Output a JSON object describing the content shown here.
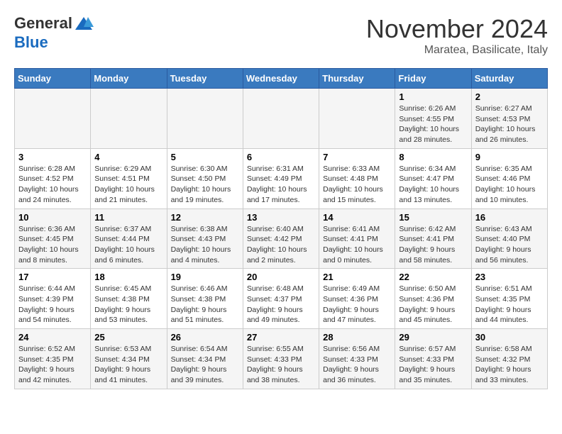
{
  "header": {
    "logo_general": "General",
    "logo_blue": "Blue",
    "month_title": "November 2024",
    "location": "Maratea, Basilicate, Italy"
  },
  "weekdays": [
    "Sunday",
    "Monday",
    "Tuesday",
    "Wednesday",
    "Thursday",
    "Friday",
    "Saturday"
  ],
  "weeks": [
    [
      {
        "day": "",
        "info": ""
      },
      {
        "day": "",
        "info": ""
      },
      {
        "day": "",
        "info": ""
      },
      {
        "day": "",
        "info": ""
      },
      {
        "day": "",
        "info": ""
      },
      {
        "day": "1",
        "info": "Sunrise: 6:26 AM\nSunset: 4:55 PM\nDaylight: 10 hours and 28 minutes."
      },
      {
        "day": "2",
        "info": "Sunrise: 6:27 AM\nSunset: 4:53 PM\nDaylight: 10 hours and 26 minutes."
      }
    ],
    [
      {
        "day": "3",
        "info": "Sunrise: 6:28 AM\nSunset: 4:52 PM\nDaylight: 10 hours and 24 minutes."
      },
      {
        "day": "4",
        "info": "Sunrise: 6:29 AM\nSunset: 4:51 PM\nDaylight: 10 hours and 21 minutes."
      },
      {
        "day": "5",
        "info": "Sunrise: 6:30 AM\nSunset: 4:50 PM\nDaylight: 10 hours and 19 minutes."
      },
      {
        "day": "6",
        "info": "Sunrise: 6:31 AM\nSunset: 4:49 PM\nDaylight: 10 hours and 17 minutes."
      },
      {
        "day": "7",
        "info": "Sunrise: 6:33 AM\nSunset: 4:48 PM\nDaylight: 10 hours and 15 minutes."
      },
      {
        "day": "8",
        "info": "Sunrise: 6:34 AM\nSunset: 4:47 PM\nDaylight: 10 hours and 13 minutes."
      },
      {
        "day": "9",
        "info": "Sunrise: 6:35 AM\nSunset: 4:46 PM\nDaylight: 10 hours and 10 minutes."
      }
    ],
    [
      {
        "day": "10",
        "info": "Sunrise: 6:36 AM\nSunset: 4:45 PM\nDaylight: 10 hours and 8 minutes."
      },
      {
        "day": "11",
        "info": "Sunrise: 6:37 AM\nSunset: 4:44 PM\nDaylight: 10 hours and 6 minutes."
      },
      {
        "day": "12",
        "info": "Sunrise: 6:38 AM\nSunset: 4:43 PM\nDaylight: 10 hours and 4 minutes."
      },
      {
        "day": "13",
        "info": "Sunrise: 6:40 AM\nSunset: 4:42 PM\nDaylight: 10 hours and 2 minutes."
      },
      {
        "day": "14",
        "info": "Sunrise: 6:41 AM\nSunset: 4:41 PM\nDaylight: 10 hours and 0 minutes."
      },
      {
        "day": "15",
        "info": "Sunrise: 6:42 AM\nSunset: 4:41 PM\nDaylight: 9 hours and 58 minutes."
      },
      {
        "day": "16",
        "info": "Sunrise: 6:43 AM\nSunset: 4:40 PM\nDaylight: 9 hours and 56 minutes."
      }
    ],
    [
      {
        "day": "17",
        "info": "Sunrise: 6:44 AM\nSunset: 4:39 PM\nDaylight: 9 hours and 54 minutes."
      },
      {
        "day": "18",
        "info": "Sunrise: 6:45 AM\nSunset: 4:38 PM\nDaylight: 9 hours and 53 minutes."
      },
      {
        "day": "19",
        "info": "Sunrise: 6:46 AM\nSunset: 4:38 PM\nDaylight: 9 hours and 51 minutes."
      },
      {
        "day": "20",
        "info": "Sunrise: 6:48 AM\nSunset: 4:37 PM\nDaylight: 9 hours and 49 minutes."
      },
      {
        "day": "21",
        "info": "Sunrise: 6:49 AM\nSunset: 4:36 PM\nDaylight: 9 hours and 47 minutes."
      },
      {
        "day": "22",
        "info": "Sunrise: 6:50 AM\nSunset: 4:36 PM\nDaylight: 9 hours and 45 minutes."
      },
      {
        "day": "23",
        "info": "Sunrise: 6:51 AM\nSunset: 4:35 PM\nDaylight: 9 hours and 44 minutes."
      }
    ],
    [
      {
        "day": "24",
        "info": "Sunrise: 6:52 AM\nSunset: 4:35 PM\nDaylight: 9 hours and 42 minutes."
      },
      {
        "day": "25",
        "info": "Sunrise: 6:53 AM\nSunset: 4:34 PM\nDaylight: 9 hours and 41 minutes."
      },
      {
        "day": "26",
        "info": "Sunrise: 6:54 AM\nSunset: 4:34 PM\nDaylight: 9 hours and 39 minutes."
      },
      {
        "day": "27",
        "info": "Sunrise: 6:55 AM\nSunset: 4:33 PM\nDaylight: 9 hours and 38 minutes."
      },
      {
        "day": "28",
        "info": "Sunrise: 6:56 AM\nSunset: 4:33 PM\nDaylight: 9 hours and 36 minutes."
      },
      {
        "day": "29",
        "info": "Sunrise: 6:57 AM\nSunset: 4:33 PM\nDaylight: 9 hours and 35 minutes."
      },
      {
        "day": "30",
        "info": "Sunrise: 6:58 AM\nSunset: 4:32 PM\nDaylight: 9 hours and 33 minutes."
      }
    ]
  ]
}
